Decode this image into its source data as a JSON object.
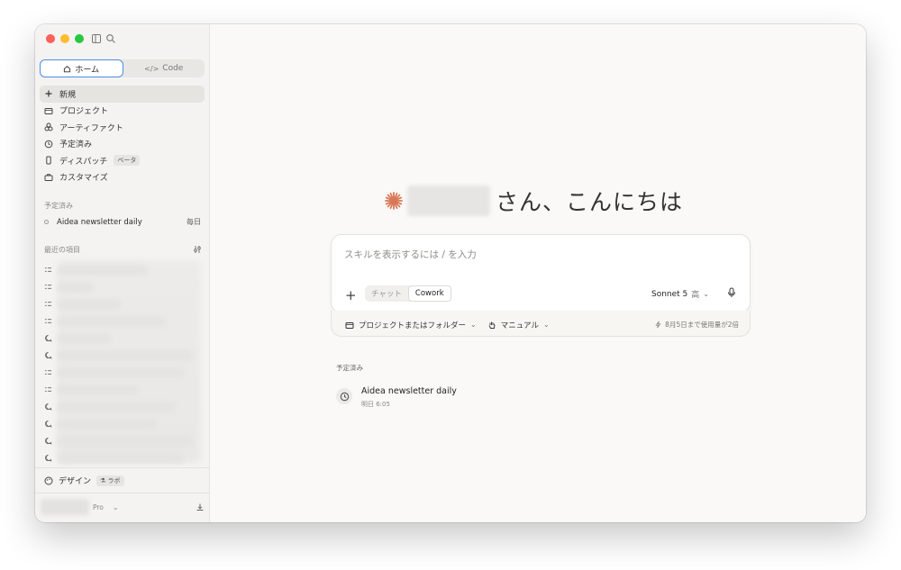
{
  "sidebar": {
    "toggle": {
      "home_label": "ホーム",
      "code_label": "Code"
    },
    "nav": [
      {
        "label": "新規",
        "icon": "plus-icon"
      },
      {
        "label": "プロジェクト",
        "icon": "folder-icon"
      },
      {
        "label": "アーティファクト",
        "icon": "artifacts-icon"
      },
      {
        "label": "予定済み",
        "icon": "clock-icon"
      },
      {
        "label": "ディスパッチ",
        "icon": "phone-icon",
        "badge": "ベータ"
      },
      {
        "label": "カスタマイズ",
        "icon": "briefcase-icon"
      }
    ],
    "scheduled_section": "予定済み",
    "scheduled_item": {
      "label": "Aidea newsletter daily",
      "frequency": "毎日"
    },
    "recent_section": "最近の項目",
    "design": {
      "label": "デザイン",
      "badge": "ラボ"
    },
    "footer": {
      "plan": "Pro"
    }
  },
  "main": {
    "greeting": "さん、こんにちは",
    "composer": {
      "placeholder": "スキルを表示するには / を入力",
      "mode_chat": "チャット",
      "mode_cowork": "Cowork",
      "model": "Sonnet 5",
      "effort": "高"
    },
    "subbar": {
      "project": "プロジェクトまたはフォルダー",
      "approval": "マニュアル",
      "usage": "8月5日まで使用量が2倍"
    },
    "scheduled_title": "予定済み",
    "task": {
      "title": "Aidea newsletter daily",
      "time": "明日 6:05"
    }
  },
  "colors": {
    "accent": "#d97757",
    "selection_border": "#4a90e2"
  }
}
